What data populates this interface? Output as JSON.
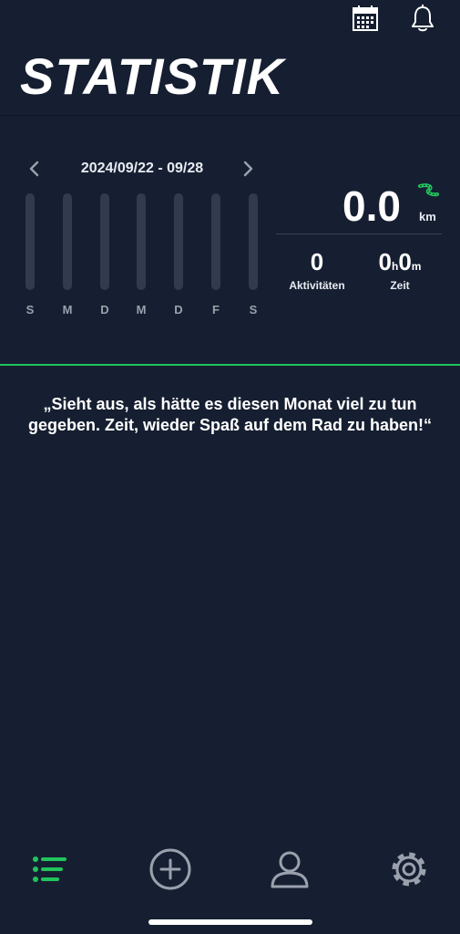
{
  "header": {
    "title": "STATISTIK",
    "icons": [
      "calendar-icon",
      "bell-icon"
    ]
  },
  "week": {
    "range": "2024/09/22 - 09/28",
    "days": [
      "S",
      "M",
      "D",
      "M",
      "D",
      "F",
      "S"
    ],
    "distances_km": [
      0,
      0,
      0,
      0,
      0,
      0,
      0
    ]
  },
  "stats": {
    "distance": "0.0",
    "distance_unit": "km",
    "activities": "0",
    "activities_label": "Aktivitäten",
    "time_hours": "0",
    "time_hours_unit": "h",
    "time_minutes": "0",
    "time_minutes_unit": "m",
    "time_label": "Zeit"
  },
  "message": "„Sieht aus, als hätte es diesen Monat viel zu tun gegeben. Zeit, wieder Spaß auf dem Rad zu haben!“",
  "bottom_nav": {
    "items": [
      "list-icon",
      "add-circle-icon",
      "user-icon",
      "gear-icon"
    ],
    "active": "list-icon"
  },
  "colors": {
    "background": "#161f31",
    "accent": "#21c45c",
    "bar_track": "#323b4d",
    "muted_text": "#9aa1ad"
  }
}
